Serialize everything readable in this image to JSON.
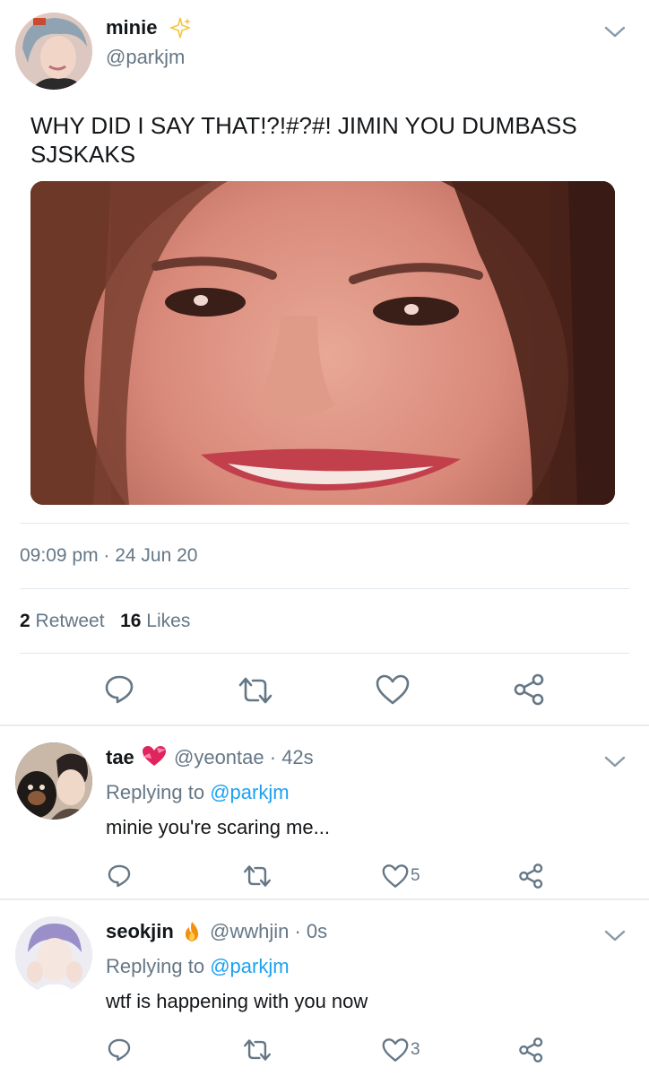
{
  "main_tweet": {
    "display_name": "minie",
    "name_emoji": "sparkles-icon",
    "handle": "@parkjm",
    "text": "WHY DID I SAY THAT!?!#?#! JIMIN YOU DUMBASS SJSKAKS",
    "timestamp": "09:09 pm · 24 Jun 20",
    "retweet_count": "2",
    "retweet_label": "Retweet",
    "like_count": "16",
    "like_label": "Likes"
  },
  "replies": [
    {
      "display_name": "tae",
      "name_emoji": "heart-with-ribbon-icon",
      "handle": "@yeontae",
      "time": "· 42s",
      "replying_prefix": "Replying to",
      "replying_to": "@parkjm",
      "text": "minie you're scaring me...",
      "like_count": "5"
    },
    {
      "display_name": "seokjin",
      "name_emoji": "fire-icon",
      "handle": "@wwhjin",
      "time": "· 0s",
      "replying_prefix": "Replying to",
      "replying_to": "@parkjm",
      "text": "wtf is happening with you now",
      "like_count": "3"
    }
  ],
  "colors": {
    "text_primary": "#14171a",
    "text_secondary": "#657786",
    "link": "#1da1f2",
    "divider": "#e1e8ed"
  }
}
